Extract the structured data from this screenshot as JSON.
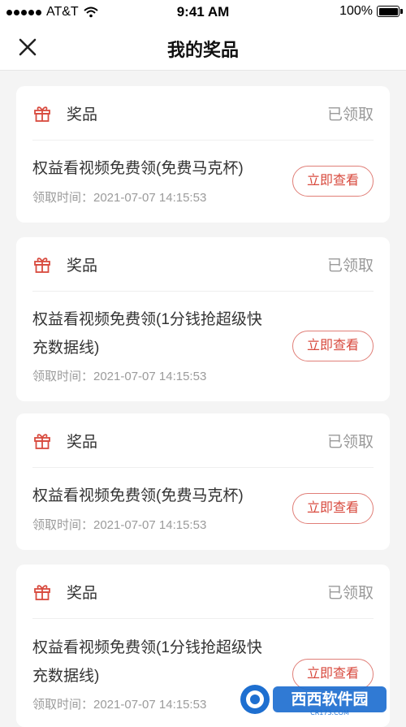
{
  "status_bar": {
    "carrier": "AT&T",
    "time": "9:41 AM",
    "battery": "100%"
  },
  "header": {
    "title": "我的奖品"
  },
  "cards": [
    {
      "label": "奖品",
      "status": "已领取",
      "title": "权益看视频免费领(免费马克杯)",
      "time": "领取时间：2021-07-07 14:15:53",
      "button": "立即查看"
    },
    {
      "label": "奖品",
      "status": "已领取",
      "title": "权益看视频免费领(1分钱抢超级快充数据线)",
      "time": "领取时间：2021-07-07 14:15:53",
      "button": "立即查看"
    },
    {
      "label": "奖品",
      "status": "已领取",
      "title": "权益看视频免费领(免费马克杯)",
      "time": "领取时间：2021-07-07 14:15:53",
      "button": "立即查看"
    },
    {
      "label": "奖品",
      "status": "已领取",
      "title": "权益看视频免费领(1分钱抢超级快充数据线)",
      "time": "领取时间：2021-07-07 14:15:53",
      "button": "立即查看"
    }
  ],
  "watermark": {
    "name": "西西软件园",
    "url": "CR173.COM"
  },
  "colors": {
    "accent": "#d84a3e",
    "status_gray": "#9a9a9a",
    "background": "#f4f4f4"
  },
  "icons": {
    "close": "close-icon",
    "gift": "gift-icon",
    "wifi": "wifi-icon",
    "battery": "battery-icon"
  }
}
